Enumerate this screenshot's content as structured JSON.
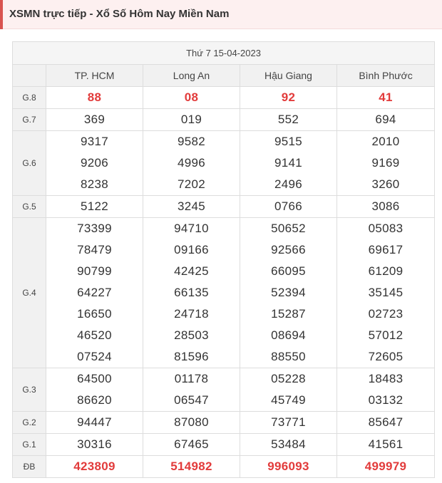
{
  "header": {
    "title": "XSMN trực tiếp - Xổ Số Hôm Nay Miền Nam"
  },
  "date_label": "Thứ 7 15-04-2023",
  "provinces": [
    "TP. HCM",
    "Long An",
    "Hậu Giang",
    "Bình Phước"
  ],
  "accent_color": "#e23b3b",
  "prizes": [
    {
      "label": "G.8",
      "rows": [
        [
          "88",
          "08",
          "92",
          "41"
        ]
      ]
    },
    {
      "label": "G.7",
      "rows": [
        [
          "369",
          "019",
          "552",
          "694"
        ]
      ]
    },
    {
      "label": "G.6",
      "rows": [
        [
          "9317",
          "9582",
          "9515",
          "2010"
        ],
        [
          "9206",
          "4996",
          "9141",
          "9169"
        ],
        [
          "8238",
          "7202",
          "2496",
          "3260"
        ]
      ]
    },
    {
      "label": "G.5",
      "rows": [
        [
          "5122",
          "3245",
          "0766",
          "3086"
        ]
      ]
    },
    {
      "label": "G.4",
      "rows": [
        [
          "73399",
          "94710",
          "50652",
          "05083"
        ],
        [
          "78479",
          "09166",
          "92566",
          "69617"
        ],
        [
          "90799",
          "42425",
          "66095",
          "61209"
        ],
        [
          "64227",
          "66135",
          "52394",
          "35145"
        ],
        [
          "16650",
          "24718",
          "15287",
          "02723"
        ],
        [
          "46520",
          "28503",
          "08694",
          "57012"
        ],
        [
          "07524",
          "81596",
          "88550",
          "72605"
        ]
      ]
    },
    {
      "label": "G.3",
      "rows": [
        [
          "64500",
          "01178",
          "05228",
          "18483"
        ],
        [
          "86620",
          "06547",
          "45749",
          "03132"
        ]
      ]
    },
    {
      "label": "G.2",
      "rows": [
        [
          "94447",
          "87080",
          "73771",
          "85647"
        ]
      ]
    },
    {
      "label": "G.1",
      "rows": [
        [
          "30316",
          "67465",
          "53484",
          "41561"
        ]
      ]
    },
    {
      "label": "ĐB",
      "rows": [
        [
          "423809",
          "514982",
          "996093",
          "499979"
        ]
      ]
    }
  ]
}
